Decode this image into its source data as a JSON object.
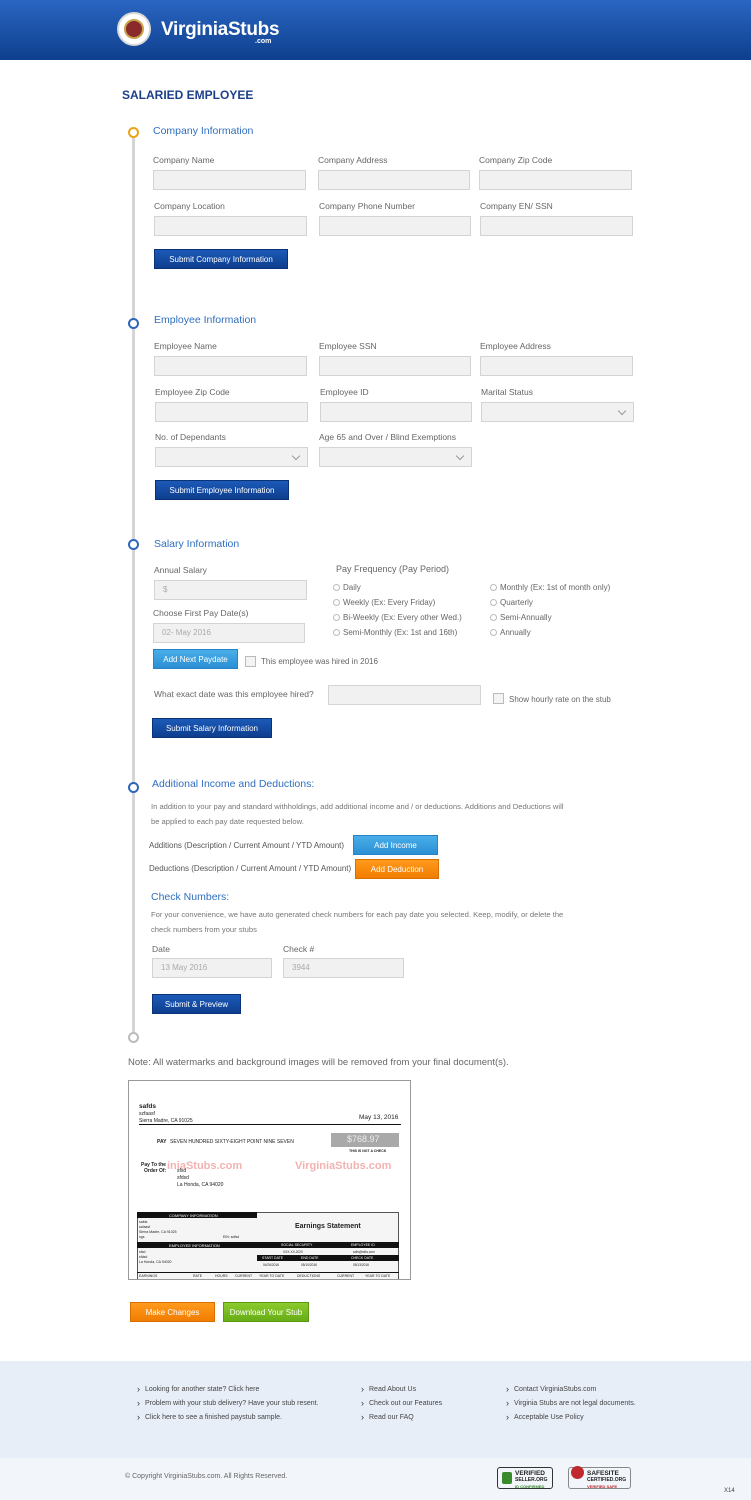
{
  "header": {
    "brand": "VirginiaStubs",
    "brand_suffix": ".com"
  },
  "page_title": "SALARIED EMPLOYEE",
  "company": {
    "title": "Company Information",
    "labels": [
      "Company Name",
      "Company Address",
      "Company Zip Code",
      "Company Location",
      "Company Phone Number",
      "Company EN/ SSN"
    ],
    "submit": "Submit Company Information"
  },
  "employee": {
    "title": "Employee Information",
    "labels": [
      "Employee Name",
      "Employee SSN",
      "Employee Address",
      "Employee Zip Code",
      "Employee ID",
      "Marital Status",
      "No. of Dependants",
      "Age 65 and Over / Blind Exemptions"
    ],
    "submit": "Submit Employee Information"
  },
  "salary": {
    "title": "Salary Information",
    "annual_label": "Annual Salary",
    "annual_placeholder": "$",
    "pay_freq_label": "Pay Frequency (Pay Period)",
    "freq_options": [
      "Daily",
      "Weekly (Ex: Every Friday)",
      "Bi-Weekly (Ex: Every other Wed.)",
      "Semi-Monthly (Ex: 1st and 16th)",
      "Monthly (Ex: 1st of month only)",
      "Quarterly",
      "Semi-Annually",
      "Annually"
    ],
    "first_pay_label": "Choose First Pay Date(s)",
    "first_pay_value": "02- May 2016",
    "add_paydate": "Add Next Paydate",
    "hired_2016": "This employee was hired in 2016",
    "hired_question": "What exact date was this employee hired?",
    "hourly_rate": "Show hourly rate on the stub",
    "submit": "Submit Salary Information"
  },
  "additional": {
    "title": "Additional Income and Deductions:",
    "desc1": "In addition to your pay and standard withholdings, add additional income and / or deductions. Additions and Deductions will",
    "desc2": "be applied to each pay date requested below.",
    "additions_label": "Additions (Description / Current Amount / YTD Amount)",
    "add_income": "Add Income",
    "deductions_label": "Deductions (Description / Current Amount / YTD Amount)",
    "add_deduction": "Add Deduction"
  },
  "checks": {
    "title": "Check Numbers:",
    "desc1": "For your convenience, we have auto generated check numbers for each pay date you selected. Keep, modify, or delete the",
    "desc2": "check numbers from your stubs",
    "date_label": "Date",
    "date_value": "13 May 2016",
    "check_label": "Check #",
    "check_value": "3944",
    "submit": "Submit & Preview"
  },
  "note": "Note: All watermarks and background images will be removed from your final document(s).",
  "stub": {
    "company_name": "safds",
    "company_line2": "szfaasf",
    "company_city": "Sierra Madre, CA 91025",
    "date": "May 13, 2016",
    "pay_label": "PAY",
    "pay_words": "SEVEN HUNDRED SIXTY-EIGHT POINT NINE SEVEN",
    "amount": "$768.97",
    "not_check": "THIS IS NOT A CHECK",
    "pay_to": "Pay To the",
    "order_of": "Order Of:",
    "payee1": "sfsd",
    "payee2": "sfdsd",
    "payee_city": "La Honda, CA 94020",
    "watermark": "VirginiaStubs.com",
    "watermark_short": "iniaStubs.com",
    "company_info": "COMPANY INFORMATION",
    "ci_lines": [
      "safds",
      "szfaasf",
      "Sierra Madre, CA 91025",
      "sgs"
    ],
    "ein": "EIN: sdfsd",
    "earnings": "Earnings Statement",
    "employee_info": "EMPLOYEE INFORMATION",
    "social": "SOCIAL SECURITY",
    "employee_id": "EMPLOYEE ID",
    "ssn_val": "XXX-XX-2020",
    "id_val": "sdfs@sfds.com",
    "ei_lines": [
      "sfsd",
      "sfdsd",
      "La Honda, CA 94020"
    ],
    "start_date": "START DATE",
    "end_date": "END DATE",
    "check_date": "CHECK DATE",
    "start_val": "04/26/2016",
    "end_val": "05/10/2016",
    "check_val": "05/13/2016",
    "cols": [
      "EARNINGS",
      "RATE",
      "HOURS",
      "CURRENT",
      "YEAR TO DATE",
      "DEDUCTIONS",
      "CURRENT",
      "YEAR TO DATE"
    ]
  },
  "actions": {
    "make_changes": "Make Changes",
    "download": "Download Your Stub"
  },
  "footer": {
    "col1": [
      "Looking for another state? Click here",
      "Problem with your stub delivery? Have your stub resent.",
      "Click here to see a finished paystub sample."
    ],
    "col2": [
      "Read About Us",
      "Check out our Features",
      "Read our FAQ"
    ],
    "col3": [
      "Contact VirginiaStubs.com",
      "Virginia Stubs are not legal documents.",
      "Acceptable Use Policy"
    ],
    "copyright": "© Copyright VirginiaStubs.com. All Rights Reserved.",
    "badge1_a": "VERIFIED",
    "badge1_b": "SELLER.ORG",
    "badge1_c": "ID CONFIRMED",
    "badge2_a": "SAFESITE",
    "badge2_b": "CERTIFIED.ORG",
    "badge2_c": "VERIFIED SAFE",
    "corner": "X14"
  },
  "colors": {
    "brand_blue": "#0e3f8d",
    "accent_blue": "#2f6fbe",
    "orange": "#f17d00",
    "green": "#67ad16"
  }
}
